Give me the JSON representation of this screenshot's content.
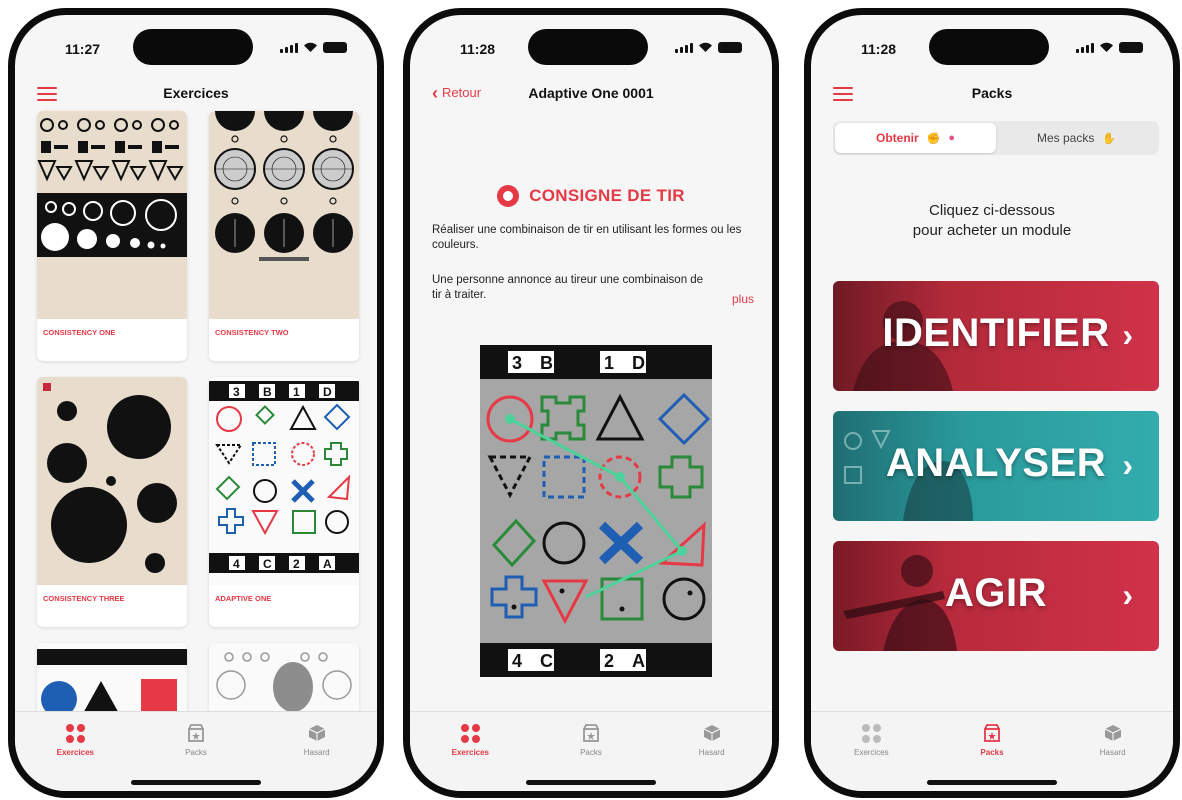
{
  "status_times": [
    "11:27",
    "11:28",
    "11:28"
  ],
  "screen1": {
    "title": "Exercices",
    "cards": [
      "CONSISTENCY ONE",
      "CONSISTENCY TWO",
      "CONSISTENCY THREE",
      "ADAPTIVE ONE"
    ]
  },
  "screen2": {
    "back_label": "Retour",
    "title": "Adaptive One 0001",
    "consigne_title": "CONSIGNE DE TIR",
    "para1": "Réaliser une combinaison de tir en utilisant les formes ou les couleurs.",
    "para2": "Une personne annonce au tireur une combinaison de tir à traiter.",
    "more_label": "plus",
    "target_top": [
      "3",
      "B",
      "1",
      "D"
    ],
    "target_bottom": [
      "4",
      "C",
      "2",
      "A"
    ]
  },
  "screen3": {
    "title": "Packs",
    "seg_obtain": "Obtenir",
    "seg_mine": "Mes packs",
    "cta_line1": "Cliquez ci-dessous",
    "cta_line2": "pour acheter un module",
    "packs": [
      {
        "label": "IDENTIFIER",
        "color": "#c8283c"
      },
      {
        "label": "ANALYSER",
        "color": "#2a9a9c"
      },
      {
        "label": "AGIR",
        "color": "#c8283c"
      }
    ]
  },
  "tabs": {
    "exercices": "Exercices",
    "packs": "Packs",
    "hasard": "Hasard"
  },
  "colors": {
    "accent": "#e63946",
    "teal": "#2a9a9c",
    "target_bg": "#e8dccd"
  }
}
